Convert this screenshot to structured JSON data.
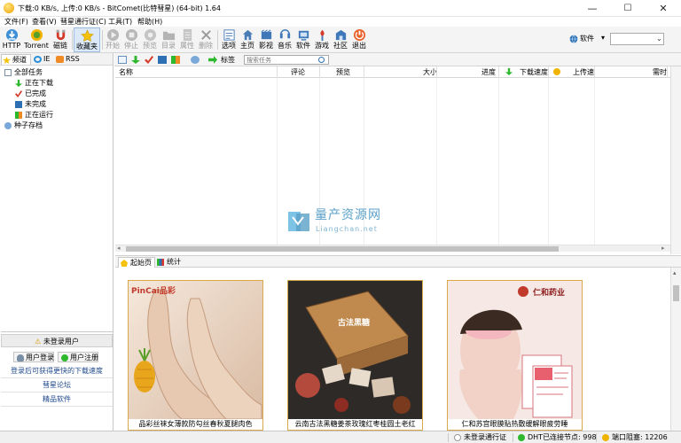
{
  "window": {
    "title": "下载:0 KB/s, 上传:0 KB/s - BitComet(比特彗星) (64-bit) 1.64",
    "minimize": "—",
    "maximize": "☐",
    "close": "✕"
  },
  "menu": [
    "文件(F)",
    "查看(V)",
    "彗星通行证(C)",
    "工具(T)",
    "帮助(H)"
  ],
  "toolbar": {
    "buttons": [
      {
        "label": "HTTP",
        "icon": "http-download-icon",
        "enabled": true
      },
      {
        "label": "Torrent",
        "icon": "torrent-icon",
        "enabled": true
      },
      {
        "label": "磁链",
        "icon": "magnet-icon",
        "enabled": true
      },
      {
        "label": "收藏夹",
        "icon": "favorites-star-icon",
        "enabled": true,
        "active": true
      },
      {
        "label": "开始",
        "icon": "start-icon",
        "enabled": false
      },
      {
        "label": "停止",
        "icon": "stop-icon",
        "enabled": false
      },
      {
        "label": "预览",
        "icon": "preview-icon",
        "enabled": false
      },
      {
        "label": "目录",
        "icon": "folder-icon",
        "enabled": false
      },
      {
        "label": "属性",
        "icon": "properties-icon",
        "enabled": false
      },
      {
        "label": "删除",
        "icon": "delete-icon",
        "enabled": false
      },
      {
        "label": "选项",
        "icon": "options-icon",
        "enabled": true
      },
      {
        "label": "主页",
        "icon": "home-icon",
        "enabled": true
      },
      {
        "label": "影视",
        "icon": "video-icon",
        "enabled": true
      },
      {
        "label": "音乐",
        "icon": "music-icon",
        "enabled": true
      },
      {
        "label": "软件",
        "icon": "software-icon",
        "enabled": true
      },
      {
        "label": "游戏",
        "icon": "game-icon",
        "enabled": true
      },
      {
        "label": "社区",
        "icon": "community-icon",
        "enabled": true
      },
      {
        "label": "退出",
        "icon": "exit-icon",
        "enabled": true
      }
    ],
    "category_label": "软件",
    "category_icon": "globe-icon",
    "search_combo_value": ""
  },
  "left_tabs": [
    {
      "label": "频道",
      "icon": "star-icon",
      "selected": true
    },
    {
      "label": "IE",
      "icon": "ie-icon",
      "selected": false
    },
    {
      "label": "RSS",
      "icon": "rss-icon",
      "selected": false
    }
  ],
  "tree": [
    {
      "label": "全部任务",
      "icon": "all-tasks-icon",
      "level": 0
    },
    {
      "label": "正在下载",
      "icon": "downloading-arrow-icon",
      "level": 1
    },
    {
      "label": "已完成",
      "icon": "completed-check-icon",
      "level": 1
    },
    {
      "label": "未完成",
      "icon": "incomplete-icon",
      "level": 1
    },
    {
      "label": "正在运行",
      "icon": "running-icon",
      "level": 1
    },
    {
      "label": "种子存档",
      "icon": "torrent-archive-icon",
      "level": 0
    }
  ],
  "user_panel": {
    "header": "未登录用户",
    "login": "用户登录",
    "register": "用户注册",
    "links": [
      "登录后可获得更快的下载速度",
      "彗星论坛",
      "精品软件"
    ]
  },
  "subbar": {
    "tag_label": "标签",
    "search_placeholder": "搜索任务"
  },
  "columns": [
    "名称",
    "评论",
    "预览",
    "大小",
    "进度",
    "下载速度",
    "上传速",
    "需时"
  ],
  "bottom_tabs": [
    {
      "label": "起始页",
      "icon": "start-page-icon",
      "selected": true
    },
    {
      "label": "统计",
      "icon": "stats-icon",
      "selected": false
    }
  ],
  "ads": [
    {
      "title": "品彩丝袜女薄款防勾丝春秋夏腿肉色",
      "brand": "PinCai品彩",
      "colors": [
        "#e9d5c2",
        "#c9a48a"
      ]
    },
    {
      "title": "云南古法黑糖姜茶玫瑰红枣桂圆土老红",
      "brand": "古法黑糖",
      "colors": [
        "#2e2a28",
        "#b34a3c"
      ]
    },
    {
      "title": "仁和苏宫眼膜贴热敷缓解眼疲劳睡",
      "brand": "仁和药业",
      "colors": [
        "#f3e3de",
        "#d7737d"
      ]
    }
  ],
  "watermark": {
    "text": "量产资源网",
    "url": "Liangchan.net"
  },
  "status": {
    "passport": "未登录通行证",
    "dht": "DHT已连接节点: 998",
    "port": "端口阻塞: 12206"
  },
  "colors": {
    "accent": "#2d6fb2",
    "status_green": "#2eb82e",
    "status_yellow": "#f0b400",
    "ad_border": "#d8a84a"
  }
}
